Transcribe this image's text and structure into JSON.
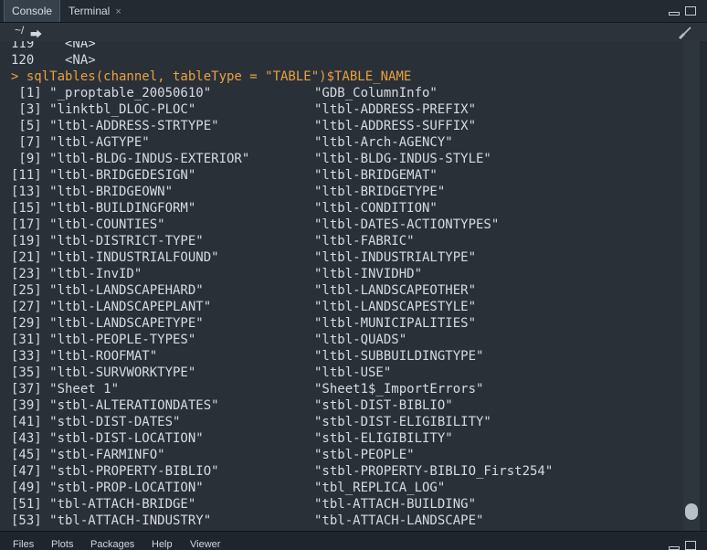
{
  "tabs": {
    "console": "Console",
    "terminal": "Terminal",
    "close_icon": "×"
  },
  "path": {
    "label": "~/",
    "arrow": "⮕"
  },
  "bottom_tabs": {
    "files": "Files",
    "plots": "Plots",
    "packages": "Packages",
    "help": "Help",
    "viewer": "Viewer"
  },
  "console": {
    "lines": [
      {
        "left": "119    <NA>",
        "right": ""
      },
      {
        "left": "120    <NA>",
        "right": ""
      },
      {
        "prompt": "> ",
        "left": "sqlTables(channel, tableType = \"TABLE\")$TABLE_NAME",
        "right": ""
      },
      {
        "left": " [1] \"_proptable_20050610\"",
        "right": "\"GDB_ColumnInfo\""
      },
      {
        "left": " [3] \"linktbl_DLOC-PLOC\"",
        "right": "\"ltbl-ADDRESS-PREFIX\""
      },
      {
        "left": " [5] \"ltbl-ADDRESS-STRTYPE\"",
        "right": "\"ltbl-ADDRESS-SUFFIX\""
      },
      {
        "left": " [7] \"ltbl-AGTYPE\"",
        "right": "\"ltbl-Arch-AGENCY\""
      },
      {
        "left": " [9] \"ltbl-BLDG-INDUS-EXTERIOR\"",
        "right": "\"ltbl-BLDG-INDUS-STYLE\""
      },
      {
        "left": "[11] \"ltbl-BRIDGEDESIGN\"",
        "right": "\"ltbl-BRIDGEMAT\""
      },
      {
        "left": "[13] \"ltbl-BRIDGEOWN\"",
        "right": "\"ltbl-BRIDGETYPE\""
      },
      {
        "left": "[15] \"ltbl-BUILDINGFORM\"",
        "right": "\"ltbl-CONDITION\""
      },
      {
        "left": "[17] \"ltbl-COUNTIES\"",
        "right": "\"ltbl-DATES-ACTIONTYPES\""
      },
      {
        "left": "[19] \"ltbl-DISTRICT-TYPE\"",
        "right": "\"ltbl-FABRIC\""
      },
      {
        "left": "[21] \"ltbl-INDUSTRIALFOUND\"",
        "right": "\"ltbl-INDUSTRIALTYPE\""
      },
      {
        "left": "[23] \"ltbl-InvID\"",
        "right": "\"ltbl-INVIDHD\""
      },
      {
        "left": "[25] \"ltbl-LANDSCAPEHARD\"",
        "right": "\"ltbl-LANDSCAPEOTHER\""
      },
      {
        "left": "[27] \"ltbl-LANDSCAPEPLANT\"",
        "right": "\"ltbl-LANDSCAPESTYLE\""
      },
      {
        "left": "[29] \"ltbl-LANDSCAPETYPE\"",
        "right": "\"ltbl-MUNICIPALITIES\""
      },
      {
        "left": "[31] \"ltbl-PEOPLE-TYPES\"",
        "right": "\"ltbl-QUADS\""
      },
      {
        "left": "[33] \"ltbl-ROOFMAT\"",
        "right": "\"ltbl-SUBBUILDINGTYPE\""
      },
      {
        "left": "[35] \"ltbl-SURVWORKTYPE\"",
        "right": "\"ltbl-USE\""
      },
      {
        "left": "[37] \"Sheet 1\"",
        "right": "\"Sheet1$_ImportErrors\""
      },
      {
        "left": "[39] \"stbl-ALTERATIONDATES\"",
        "right": "\"stbl-DIST-BIBLIO\""
      },
      {
        "left": "[41] \"stbl-DIST-DATES\"",
        "right": "\"stbl-DIST-ELIGIBILITY\""
      },
      {
        "left": "[43] \"stbl-DIST-LOCATION\"",
        "right": "\"stbl-ELIGIBILITY\""
      },
      {
        "left": "[45] \"stbl-FARMINFO\"",
        "right": "\"stbl-PEOPLE\""
      },
      {
        "left": "[47] \"stbl-PROPERTY-BIBLIO\"",
        "right": "\"stbl-PROPERTY-BIBLIO_First254\""
      },
      {
        "left": "[49] \"stbl-PROP-LOCATION\"",
        "right": "\"tbl_REPLICA_LOG\""
      },
      {
        "left": "[51] \"tbl-ATTACH-BRIDGE\"",
        "right": "\"tbl-ATTACH-BUILDING\""
      },
      {
        "left": "[53] \"tbl-ATTACH-INDUSTRY\"",
        "right": "\"tbl-ATTACH-LANDSCAPE\""
      }
    ]
  },
  "colors": {
    "prompt": "#e8a23e",
    "text": "#d7dbe0",
    "background": "#2a3038"
  }
}
